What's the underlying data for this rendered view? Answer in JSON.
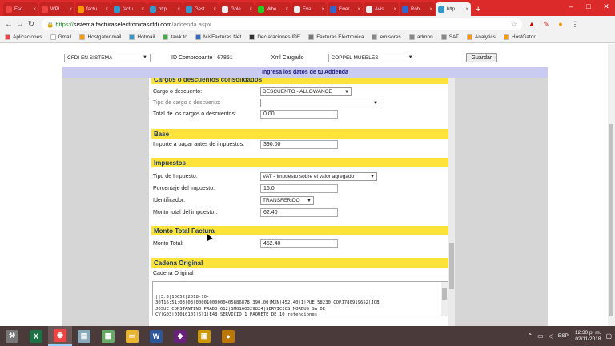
{
  "browser": {
    "tabs": [
      {
        "label": "Eso",
        "color": "#e44"
      },
      {
        "label": "WPL",
        "color": "#e44"
      },
      {
        "label": "factu",
        "color": "#f90"
      },
      {
        "label": "factu",
        "color": "#39c"
      },
      {
        "label": "http",
        "color": "#39c"
      },
      {
        "label": "Gest",
        "color": "#39c"
      },
      {
        "label": "Gole",
        "color": "#eee"
      },
      {
        "label": "Whe",
        "color": "#2c2"
      },
      {
        "label": "Eva",
        "color": "#eee"
      },
      {
        "label": "Fwer",
        "color": "#36c"
      },
      {
        "label": "Avis",
        "color": "#eee"
      },
      {
        "label": "Rob",
        "color": "#36c"
      },
      {
        "label": "http",
        "color": "#39c",
        "active": true
      }
    ],
    "newtab": "+",
    "url_secure": "https://",
    "url_host": "sistema.facturaselectronicascfdi.com",
    "url_path": "/addenda.aspx",
    "bookmarks": [
      {
        "label": "Aplicaciones",
        "color": "#e44"
      },
      {
        "label": "Gmail",
        "color": "#fff"
      },
      {
        "label": "Hostgator mail",
        "color": "#f90"
      },
      {
        "label": "Hotmail",
        "color": "#39c"
      },
      {
        "label": "tawk.to",
        "color": "#4a4"
      },
      {
        "label": "MisFacturas.Net",
        "color": "#36c"
      },
      {
        "label": "Declaraciones IDE",
        "color": "#333"
      },
      {
        "label": "Facturas Electronica",
        "color": "#777"
      },
      {
        "label": "emisores",
        "color": "#888"
      },
      {
        "label": "admon",
        "color": "#888"
      },
      {
        "label": "SAT",
        "color": "#888"
      },
      {
        "label": "Analytics",
        "color": "#f90"
      },
      {
        "label": "HostGator",
        "color": "#f90"
      }
    ]
  },
  "top": {
    "status_select": "CFDI EN SISTEMA",
    "id_label": "ID Comprobante : 67851",
    "xml_label": "Xml Cargado",
    "client_select": "COPPEL MUEBLES",
    "save_button": "Guardar"
  },
  "banner": "Ingresa los datos de tu Addenda",
  "sections": {
    "cargos": {
      "title": "Cargos o descuentos consolidados",
      "cargo_label": "Cargo o descuento:",
      "cargo_value": "DESCUENTO - ALLOWANCE",
      "tipo_label": "Tipo de cargo o descuento:",
      "tipo_value": "",
      "total_label": "Total de los cargos o descuentos:",
      "total_value": "0.00"
    },
    "base": {
      "title": "Base",
      "importe_label": "Importe a pagar antes de impuestos:",
      "importe_value": "390.00"
    },
    "impuestos": {
      "title": "Impuestos",
      "tipo_label": "Tipo de Impuesto:",
      "tipo_value": "VAT - Impuesto sobre el valor agregado",
      "porc_label": "Porcentaje del impuesto:",
      "porc_value": "16.0",
      "ident_label": "Identificador:",
      "ident_value": "TRANSFERIDO",
      "monto_label": "Monto total del impuesto.:",
      "monto_value": "62.40"
    },
    "monto_total": {
      "title": "Monto Total Factura",
      "label": "Monto Total:",
      "value": "452.40"
    },
    "cadena": {
      "title": "Cadena Original",
      "label": "Cadena Original",
      "lines": [
        "||3.3|10052|2018-10-",
        "30T16:51:03|03|00001000000405886878|390.00|MXN|452.40|I|PUE|58230|COPJ780919652|JOB",
        "JOSUE CONSTANTINO PRADO|612|SMO160329824|SERVICIOS MORBUS SA DE",
        "CV|G03|01010101|5|1|E48|SERVICIO|1 PAQUETE DE 10 retenciones",
        "CFDI|390|390.00|390.00|002|Tasa|0.160000|62.4|002|Tasa|0.160000|62.40|62.40||"
      ]
    }
  },
  "taskbar": {
    "apps": [
      {
        "name": "tools",
        "glyph": "⚒",
        "color": "#777"
      },
      {
        "name": "excel",
        "glyph": "X",
        "color": "#1e7145"
      },
      {
        "name": "chrome",
        "glyph": "◉",
        "color": "#e44"
      },
      {
        "name": "files",
        "glyph": "▤",
        "color": "#8ab"
      },
      {
        "name": "calculator",
        "glyph": "▦",
        "color": "#6a6"
      },
      {
        "name": "explorer",
        "glyph": "▭",
        "color": "#e9b530"
      },
      {
        "name": "word",
        "glyph": "W",
        "color": "#2b579a"
      },
      {
        "name": "visual-studio",
        "glyph": "◆",
        "color": "#68217a"
      },
      {
        "name": "app",
        "glyph": "▣",
        "color": "#c90"
      },
      {
        "name": "paint",
        "glyph": "●",
        "color": "#b70"
      }
    ],
    "lang": "ESP",
    "time": "12:30 p. m.",
    "date": "02/11/2018"
  }
}
